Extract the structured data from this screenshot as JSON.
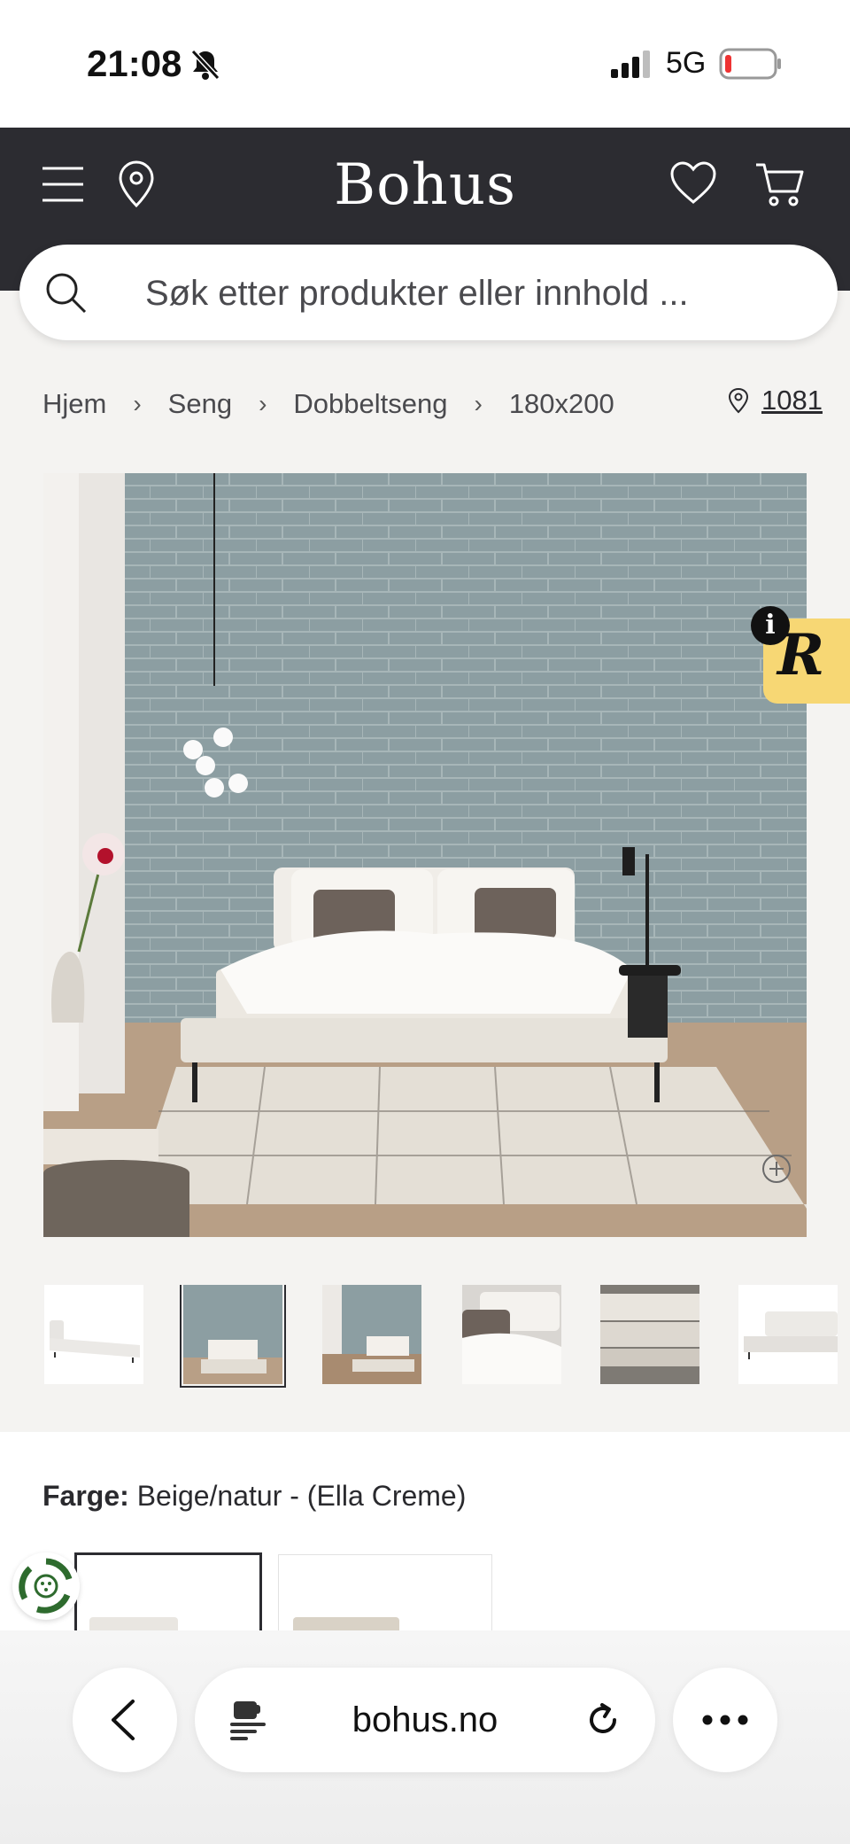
{
  "status_bar": {
    "time": "21:08",
    "network": "5G"
  },
  "header": {
    "logo": "Bohus"
  },
  "search": {
    "placeholder": "Søk etter produkter eller innhold ..."
  },
  "breadcrumb": {
    "items": [
      "Hjem",
      "Seng",
      "Dobbeltseng",
      "180x200"
    ]
  },
  "store": {
    "label": "1081"
  },
  "product": {
    "color_label": "Farge:",
    "color_value": "Beige/natur - (Ella Creme)"
  },
  "browser": {
    "url": "bohus.no"
  },
  "colors": {
    "header_bg": "#2c2c31",
    "badge_bg": "#f7d774",
    "page_bg": "#f4f3f1"
  }
}
